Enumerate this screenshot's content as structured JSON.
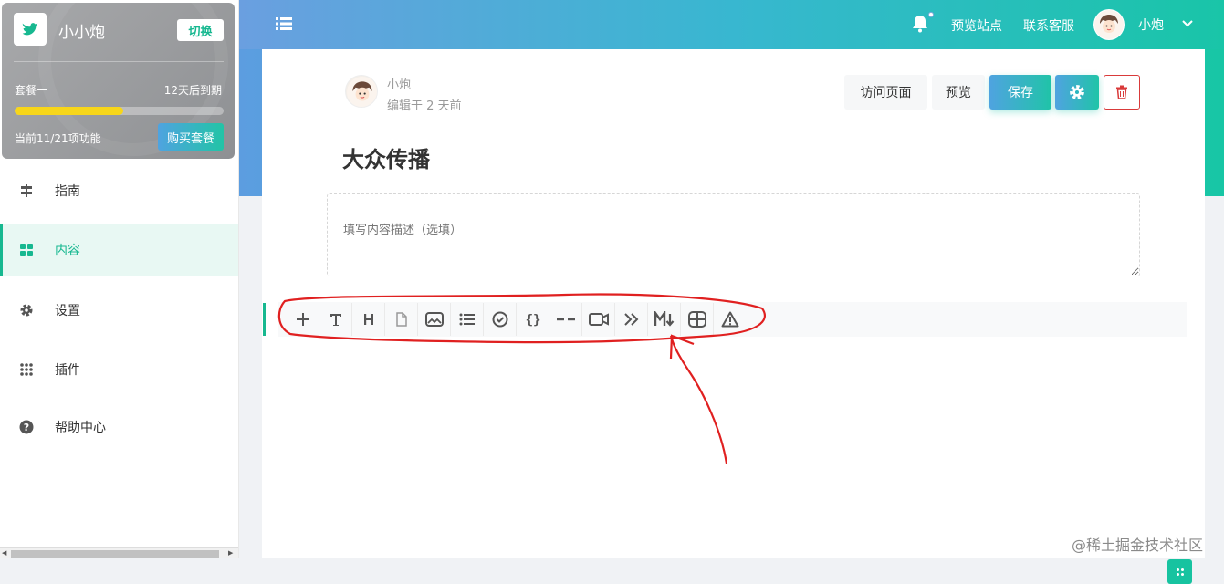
{
  "sidebar": {
    "site_name": "小小炮",
    "switch_label": "切换",
    "plan": {
      "name": "套餐一",
      "expire": "12天后到期",
      "usage_text": "当前11/21项功能",
      "buy_label": "购买套餐",
      "progress_fraction": 0.52
    },
    "nav": [
      {
        "label": "指南",
        "icon": "signpost-icon"
      },
      {
        "label": "内容",
        "icon": "grid-icon",
        "active": true
      },
      {
        "label": "设置",
        "icon": "gear-icon"
      },
      {
        "label": "插件",
        "icon": "dots-grid-icon"
      },
      {
        "label": "帮助中心",
        "icon": "help-circle-icon"
      }
    ]
  },
  "header": {
    "links": [
      "预览站点",
      "联系客服"
    ],
    "username": "小炮"
  },
  "editor": {
    "author": "小炮",
    "edited": "编辑于 2 天前",
    "buttons": {
      "visit": "访问页面",
      "preview": "预览",
      "save": "保存"
    },
    "title": "大众传播",
    "description_placeholder": "填写内容描述（选填）",
    "toolbar": [
      "plus-icon",
      "text-icon",
      "heading-icon",
      "file-icon",
      "image-icon",
      "list-icon",
      "check-circle-icon",
      "code-braces-icon",
      "divider-icon",
      "video-icon",
      "chevrons-right-icon",
      "markdown-icon",
      "table-icon",
      "warning-icon"
    ]
  },
  "colors": {
    "accent": "#17b890",
    "annotation": "#e02020"
  },
  "watermark": "@稀土掘金技术社区"
}
